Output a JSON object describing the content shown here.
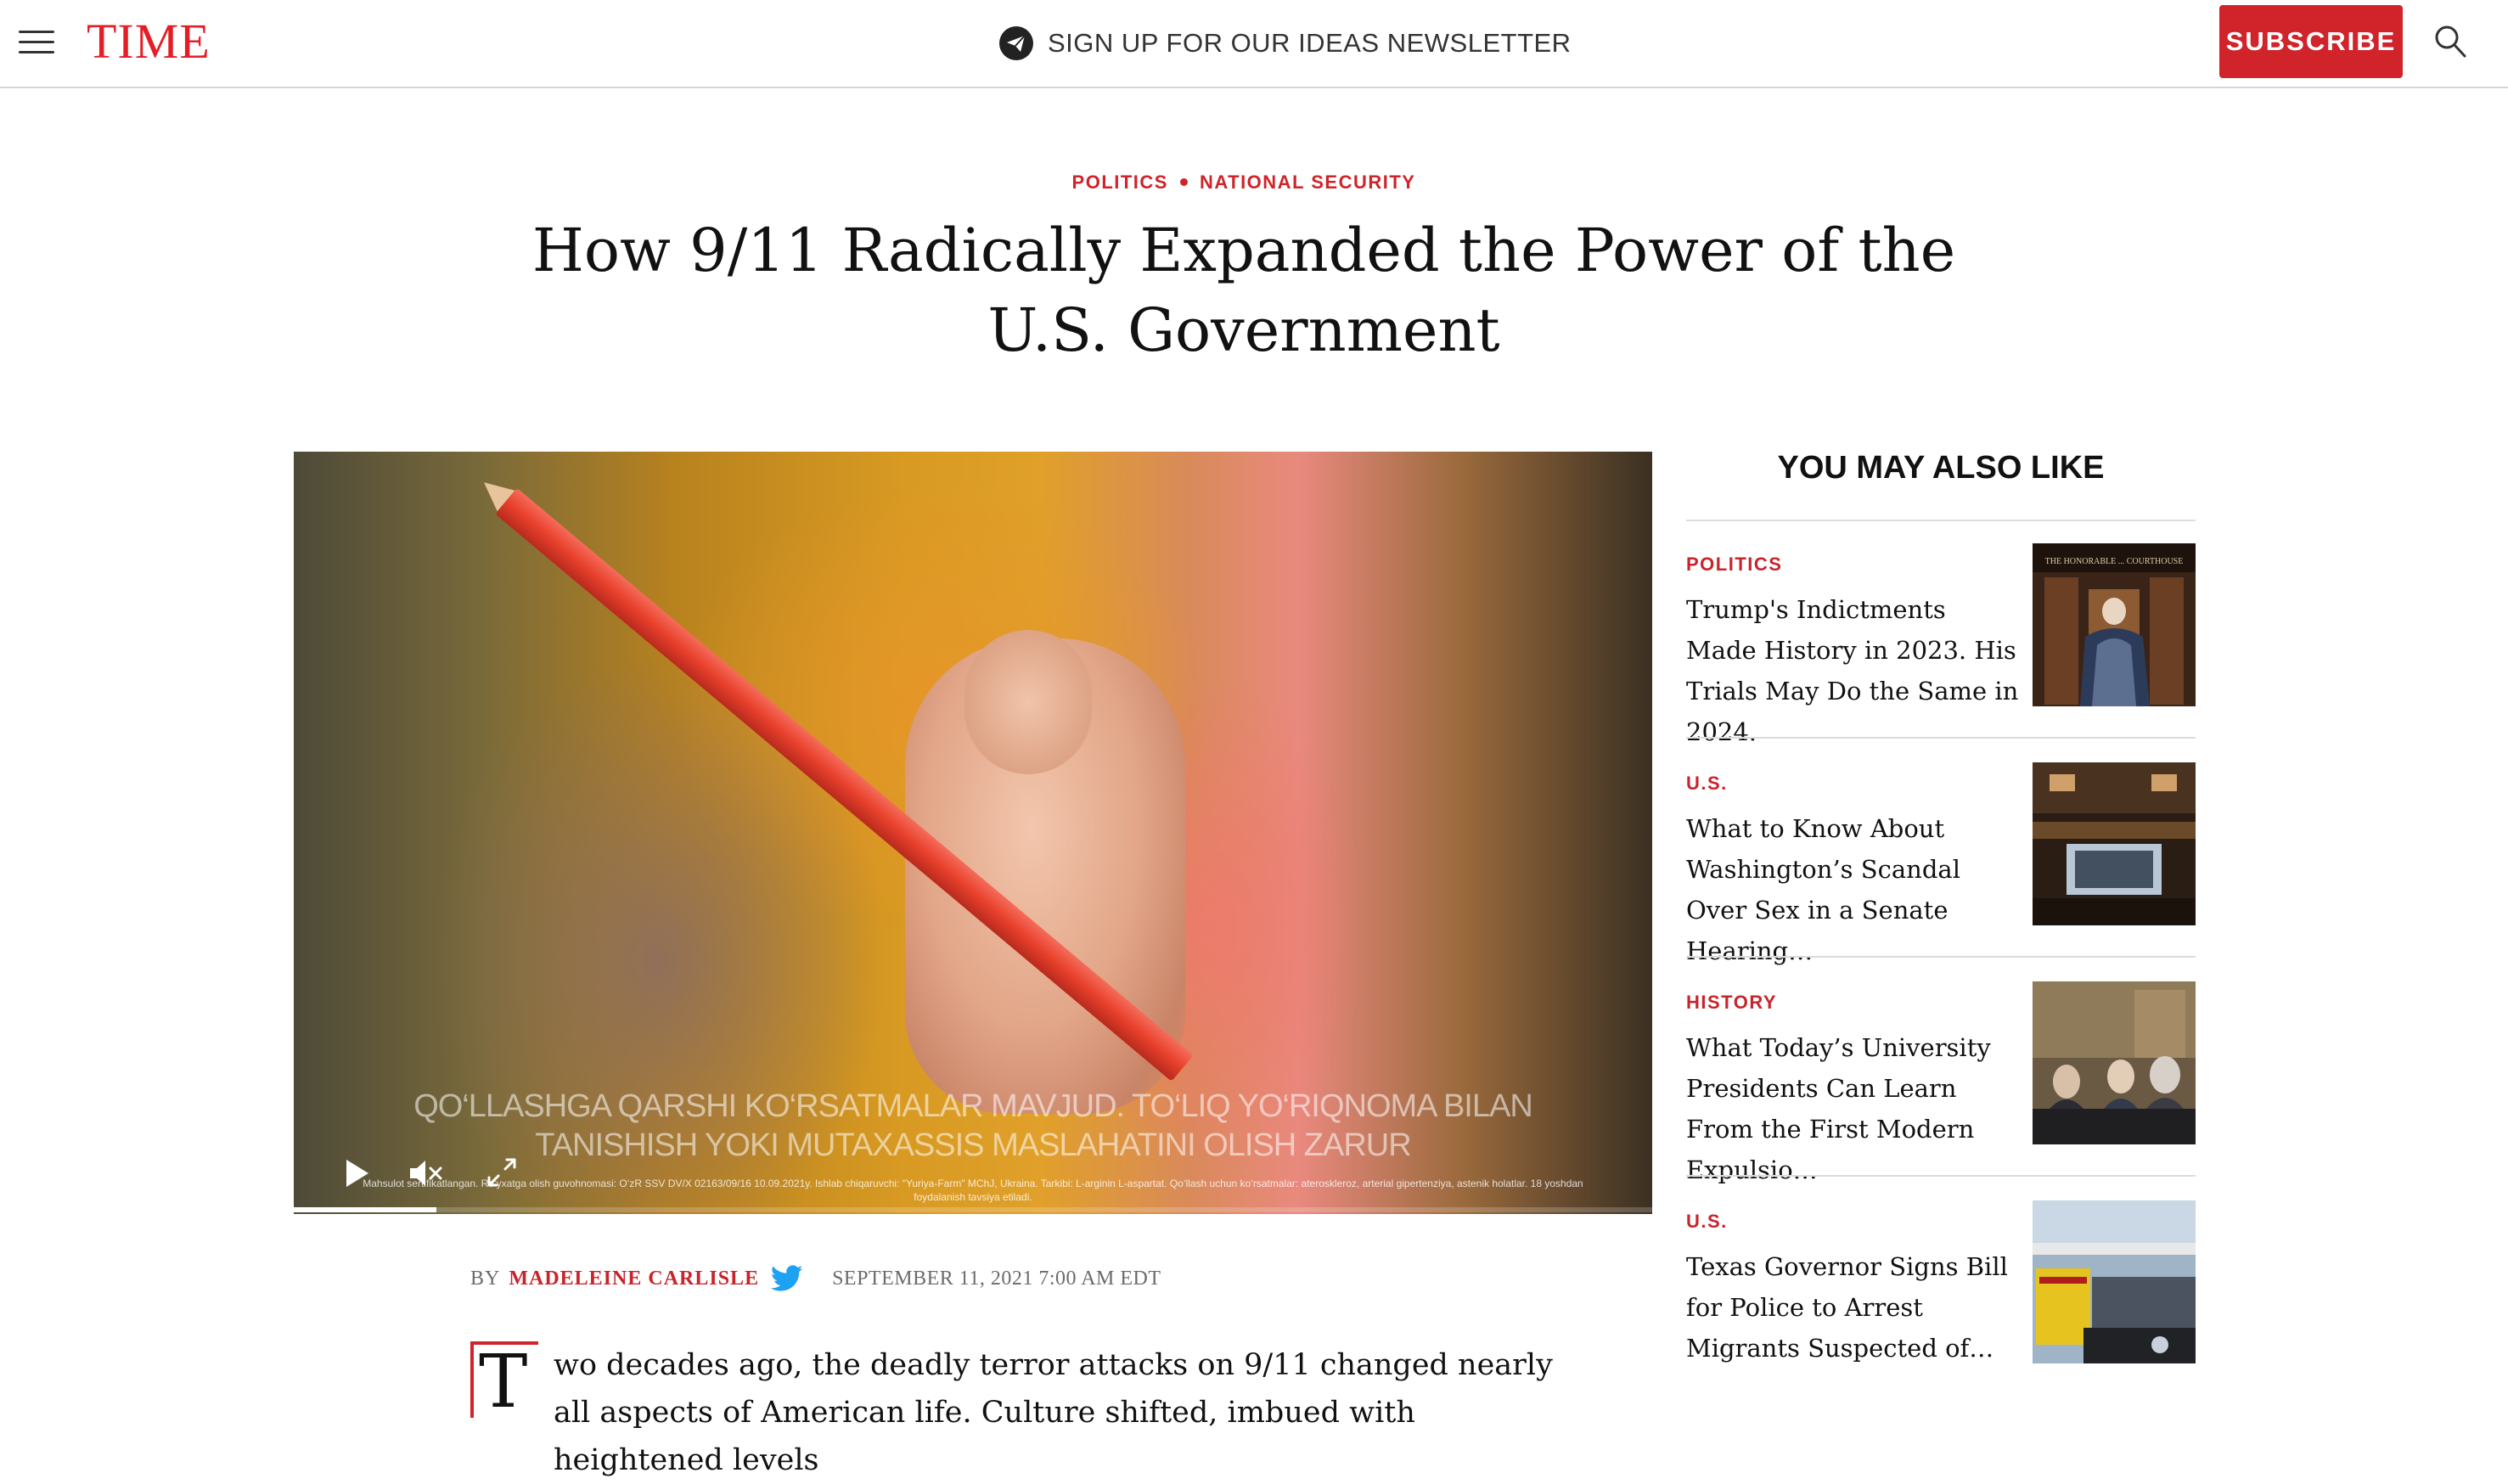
{
  "header": {
    "logo": "TIME",
    "newsletter": "SIGN UP FOR OUR IDEAS NEWSLETTER",
    "subscribe": "SUBSCRIBE"
  },
  "article": {
    "categories": [
      "POLITICS",
      "NATIONAL SECURITY"
    ],
    "title": "How 9/11 Radically Expanded the Power of the U.S. Government",
    "byline_prefix": "BY",
    "author": "MADELEINE CARLISLE",
    "date": "SEPTEMBER 11, 2021 7:00 AM EDT",
    "dropcap": "T",
    "body_first": "wo decades ago, the deadly terror attacks on 9/11 changed nearly all aspects of American life. Culture shifted, imbued with heightened levels"
  },
  "video": {
    "caption": "QO‘LLASHGA QARSHI KO‘RSATMALAR MAVJUD. TO‘LIQ YO‘RIQNOMA BILAN TANISHISH YOKI MUTAXASSIS MASLAHATINI OLISH ZARUR",
    "fineprint": "Mahsulot sertifikatlangan. Ro‘yxatga olish guvohnomasi: O‘zR SSV DV/X 02163/09/16 10.09.2021y. Ishlab chiqaruvchi: \"Yuriya-Farm\" MChJ, Ukraina. Tarkibi: L-arginin L-aspartat. Qo‘llash uchun ko‘rsatmalar: ateroskleroz, arterial gipertenziya, astenik holatlar. 18 yoshdan foydalanish tavsiya etiladi.",
    "progress": 0.105
  },
  "sidebar": {
    "title": "YOU MAY ALSO LIKE",
    "items": [
      {
        "category": "POLITICS",
        "title": "Trump's Indictments Made History in 2023. His Trials May Do the Same in 2024."
      },
      {
        "category": "U.S.",
        "title": "What to Know About Washington’s Scandal Over Sex in a Senate Hearing…"
      },
      {
        "category": "HISTORY",
        "title": "What Today’s University Presidents Can Learn From the First Modern Expulsio…"
      },
      {
        "category": "U.S.",
        "title": "Texas Governor Signs Bill for Police to Arrest Migrants Suspected of…"
      }
    ]
  },
  "colors": {
    "brand_red": "#e41e26",
    "subscribe_red": "#d0232a",
    "twitter_blue": "#1da1f2"
  }
}
